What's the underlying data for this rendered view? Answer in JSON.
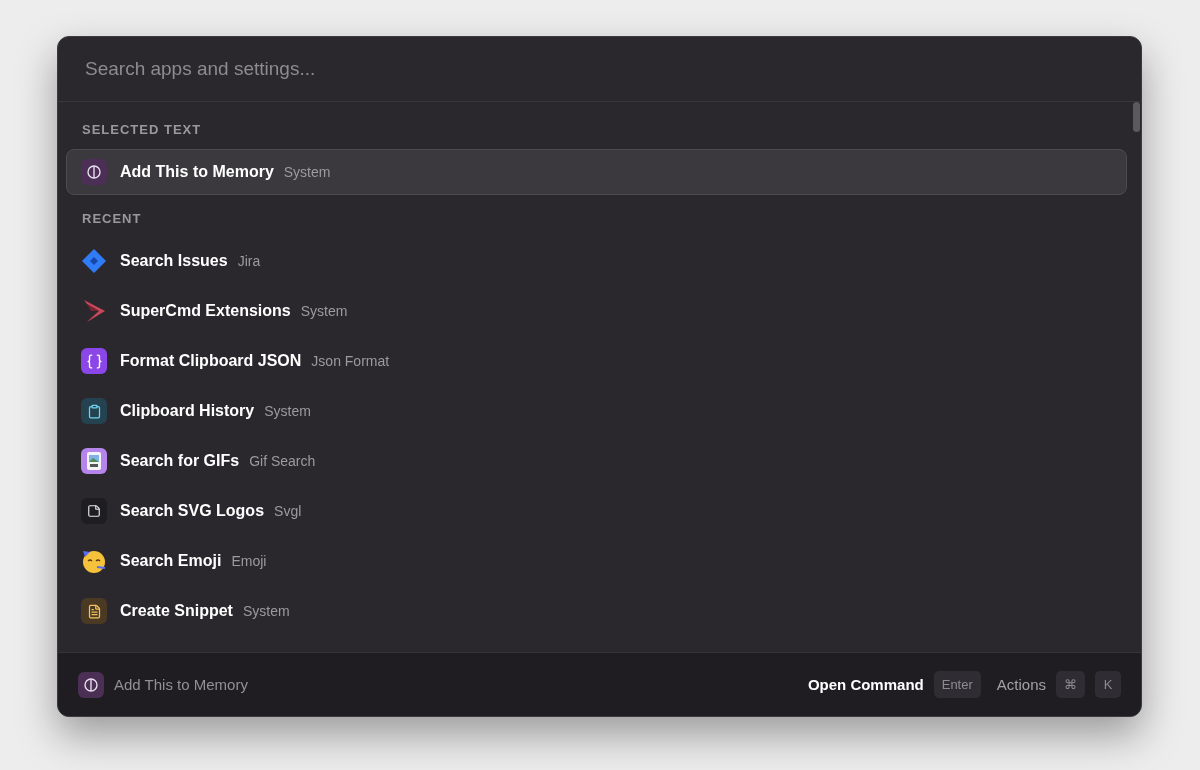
{
  "search": {
    "placeholder": "Search apps and settings..."
  },
  "sections": [
    {
      "title": "SELECTED TEXT",
      "items": [
        {
          "kind": "memory",
          "title": "Add This to Memory",
          "subtitle": "System",
          "selected": true
        }
      ]
    },
    {
      "title": "RECENT",
      "items": [
        {
          "kind": "jira",
          "title": "Search Issues",
          "subtitle": "Jira",
          "selected": false
        },
        {
          "kind": "chevron",
          "title": "SuperCmd Extensions",
          "subtitle": "System",
          "selected": false
        },
        {
          "kind": "braces",
          "title": "Format Clipboard JSON",
          "subtitle": "Json Format",
          "selected": false
        },
        {
          "kind": "clipboard",
          "title": "Clipboard History",
          "subtitle": "System",
          "selected": false
        },
        {
          "kind": "gif",
          "title": "Search for GIFs",
          "subtitle": "Gif Search",
          "selected": false
        },
        {
          "kind": "note",
          "title": "Search SVG Logos",
          "subtitle": "Svgl",
          "selected": false
        },
        {
          "kind": "emoji",
          "title": "Search Emoji",
          "subtitle": "Emoji",
          "selected": false
        },
        {
          "kind": "snippet",
          "title": "Create Snippet",
          "subtitle": "System",
          "selected": false
        }
      ]
    }
  ],
  "footer": {
    "kind": "memory",
    "title": "Add This to Memory",
    "primary_action": "Open Command",
    "primary_key": "Enter",
    "secondary_action": "Actions",
    "secondary_keys": [
      "⌘",
      "K"
    ]
  }
}
